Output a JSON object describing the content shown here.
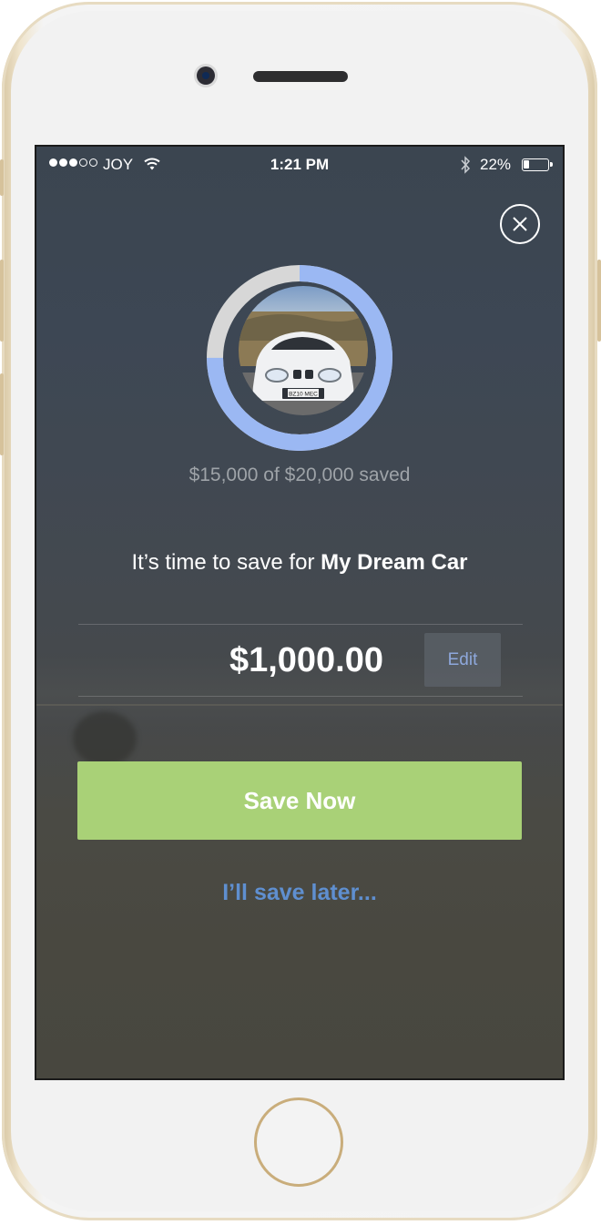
{
  "status_bar": {
    "carrier": "JOY",
    "time": "1:21 PM",
    "battery": "22%",
    "signal_strength": 3,
    "signal_max": 5
  },
  "goal": {
    "saved_text": "$15,000 of $20,000 saved",
    "progress_fraction": 0.75,
    "photo_icon": "car-photo",
    "plate_text": "BZ10 MEC"
  },
  "prompt": {
    "prefix": "It’s time to save for ",
    "goal_name": "My Dream Car"
  },
  "amount": {
    "value": "$1,000.00",
    "edit_label": "Edit"
  },
  "actions": {
    "save_now_label": "Save Now",
    "save_later_label": "I’ll save later..."
  },
  "colors": {
    "ring_progress": "#9bb8f3",
    "ring_track": "#d7d7d7",
    "save_button": "#a9d177",
    "link": "#5f8fd0",
    "edit_text": "#8ea8dc"
  }
}
